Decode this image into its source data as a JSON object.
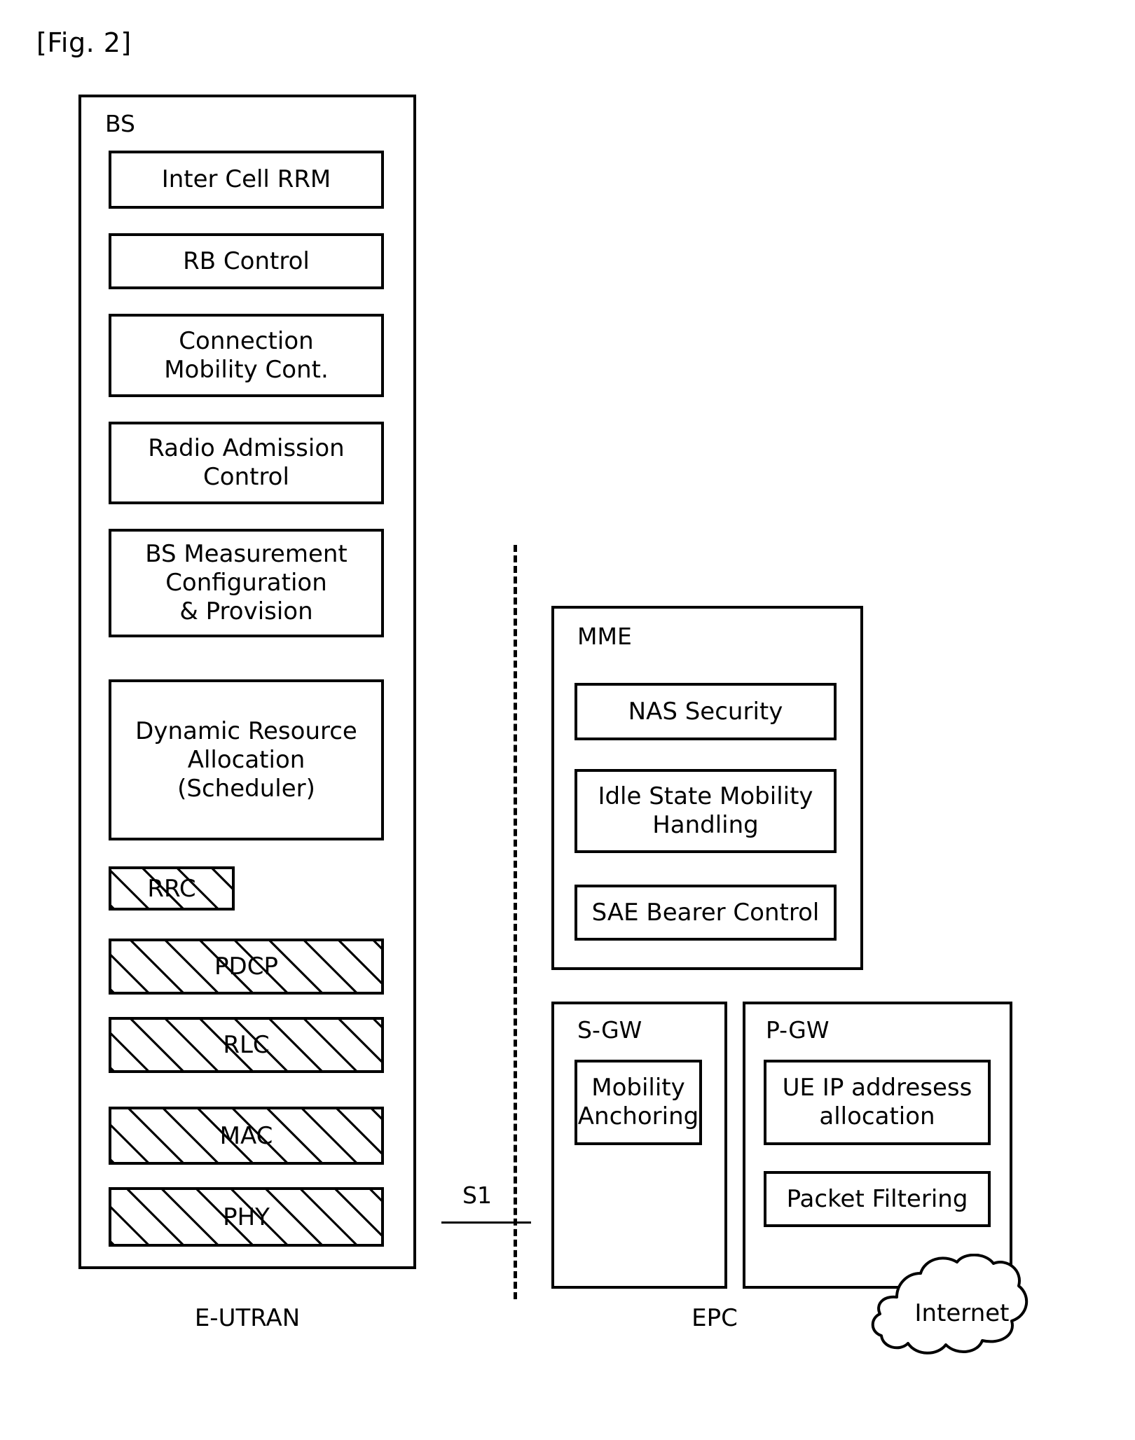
{
  "figure": {
    "label": "[Fig. 2]"
  },
  "eutran": {
    "box_title": "BS",
    "caption": "E-UTRAN",
    "function_blocks": [
      {
        "label": "Inter Cell RRM"
      },
      {
        "label": "RB Control"
      },
      {
        "label": "Connection\nMobility Cont."
      },
      {
        "label": "Radio Admission\nControl"
      },
      {
        "label": "BS Measurement\nConfiguration\n& Provision"
      },
      {
        "label": "Dynamic Resource\nAllocation\n(Scheduler)"
      }
    ],
    "protocol_layers": [
      {
        "label": "RRC"
      },
      {
        "label": "PDCP"
      },
      {
        "label": "RLC"
      },
      {
        "label": "MAC"
      },
      {
        "label": "PHY"
      }
    ]
  },
  "interface": {
    "name": "S1"
  },
  "epc": {
    "caption": "EPC",
    "mme": {
      "box_title": "MME",
      "blocks": [
        {
          "label": "NAS Security"
        },
        {
          "label": "Idle State Mobility\nHandling"
        },
        {
          "label": "SAE Bearer Control"
        }
      ]
    },
    "sgw": {
      "box_title": "S-GW",
      "blocks": [
        {
          "label": "Mobility\nAnchoring"
        }
      ]
    },
    "pgw": {
      "box_title": "P-GW",
      "blocks": [
        {
          "label": "UE IP addresess\nallocation"
        },
        {
          "label": "Packet Filtering"
        }
      ]
    }
  },
  "internet": {
    "label": "Internet"
  },
  "colors": {
    "stroke": "#000000",
    "background": "#ffffff"
  }
}
